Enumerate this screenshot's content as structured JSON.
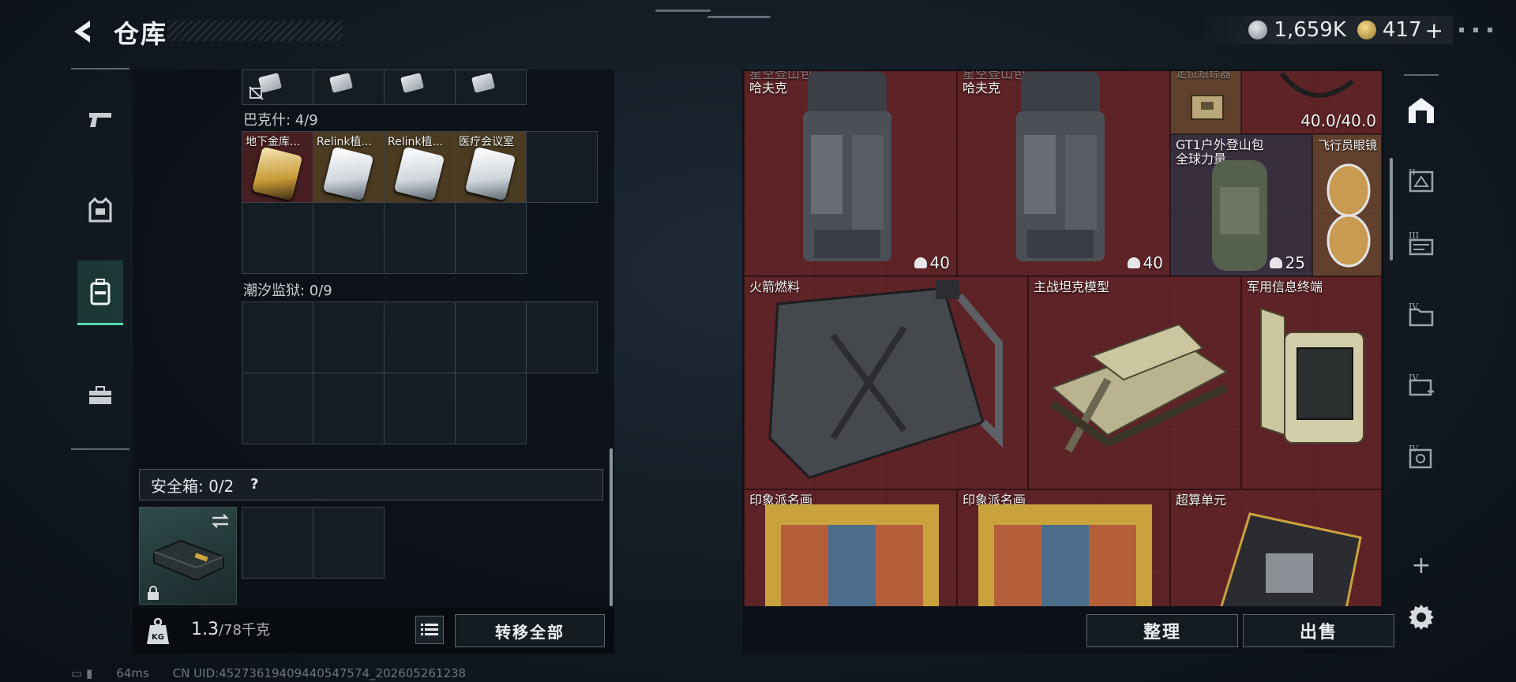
{
  "header": {
    "title": "仓库",
    "currency_silver": "1,659K",
    "currency_gold": "417",
    "currency_add": "+"
  },
  "left_nav": {
    "items": [
      {
        "icon": "pistol-icon"
      },
      {
        "icon": "armor-vest-icon"
      },
      {
        "icon": "backpack-icon",
        "active": true
      },
      {
        "icon": "toolbox-icon"
      }
    ]
  },
  "containers": {
    "bakesh_label": "巴克什: 4/9",
    "bakesh_items": [
      "地下金库...",
      "Relink植...",
      "Relink植...",
      "医疗会议室"
    ],
    "chaoxi_label": "潮汐监狱: 0/9"
  },
  "safe_box": {
    "label": "安全箱: 0/2",
    "help": "?"
  },
  "weight": {
    "value": "1.3",
    "max": "/78千克"
  },
  "buttons": {
    "transfer_all": "转移全部",
    "organize": "整理",
    "sell": "出售"
  },
  "stash_items": {
    "backpack1_name_top": "星空登山包",
    "backpack1_name": "哈夫克",
    "backpack1_count": "40",
    "backpack2_name_top": "星空登山包",
    "backpack2_name": "哈夫克",
    "backpack2_count": "40",
    "locator_name": "定位跟踪器",
    "bag_durability": "40.0/40.0",
    "gt1_name": "GT1户外登山包",
    "gt1_sub": "全球力量",
    "gt1_count": "25",
    "goggles_name": "飞行员眼镜",
    "fuel_name": "火箭燃料",
    "tank_name": "主战坦克模型",
    "terminal_name": "军用信息终端",
    "painting1_name": "印象派名画",
    "painting2_name": "印象派名画",
    "supercomputer_name": "超算单元"
  },
  "right_nav": {
    "tiers": [
      "II",
      "III",
      "IV",
      "IV",
      "IV"
    ],
    "add": "+"
  },
  "status_bar": {
    "ping": "64ms",
    "uid": "CN UID:452736194094405475​74_202605261238"
  }
}
